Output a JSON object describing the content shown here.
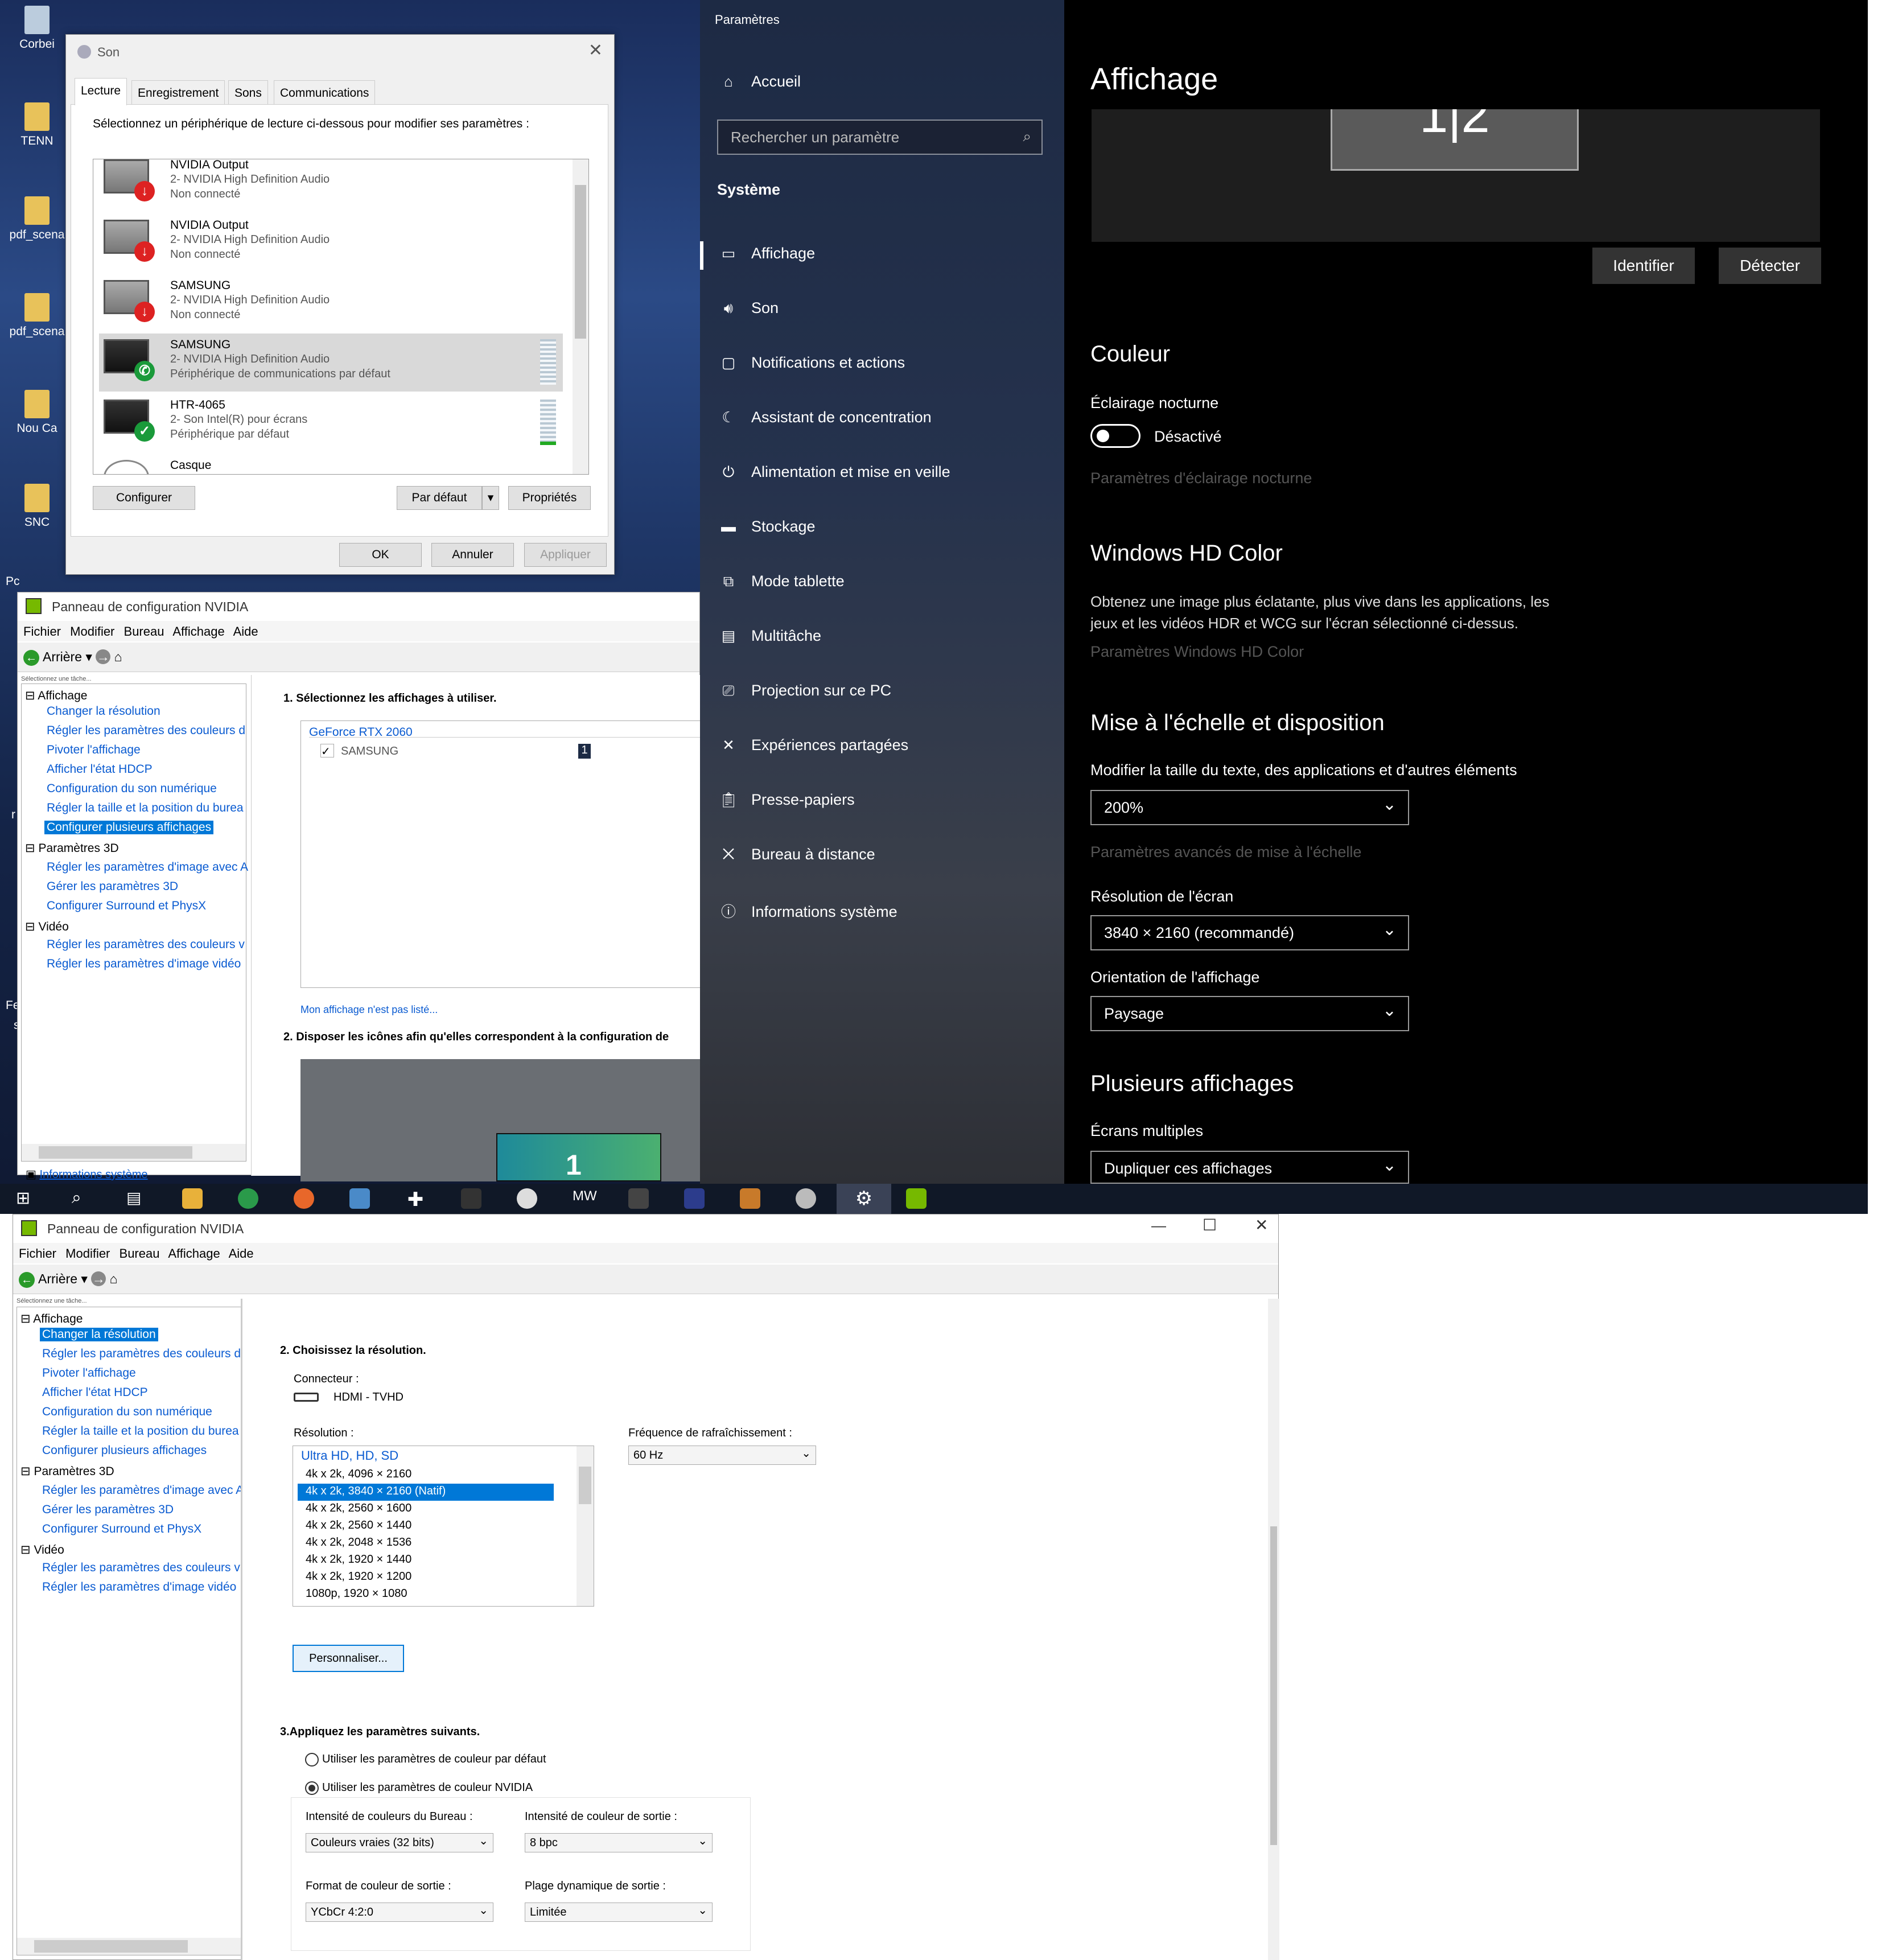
{
  "desktop": {
    "icons": [
      "Corbei",
      "TENN",
      "pdf_scena",
      "pdf_scena",
      "Nou Ca",
      "SNC"
    ],
    "side_labels": [
      "Pc",
      "r",
      "Fe",
      "s"
    ]
  },
  "sound": {
    "title": "Son",
    "tabs": [
      "Lecture",
      "Enregistrement",
      "Sons",
      "Communications"
    ],
    "instruction": "Sélectionnez un périphérique de lecture ci-dessous pour modifier ses paramètres :",
    "devices": [
      {
        "name": "NVIDIA Output",
        "line2": "2- NVIDIA High Definition Audio",
        "line3": "Non connecté",
        "status": "disconnected"
      },
      {
        "name": "NVIDIA Output",
        "line2": "2- NVIDIA High Definition Audio",
        "line3": "Non connecté",
        "status": "disconnected"
      },
      {
        "name": "SAMSUNG",
        "line2": "2- NVIDIA High Definition Audio",
        "line3": "Non connecté",
        "status": "disconnected"
      },
      {
        "name": "SAMSUNG",
        "line2": "2- NVIDIA High Definition Audio",
        "line3": "Périphérique de communications par défaut",
        "status": "comm"
      },
      {
        "name": "HTR-4065",
        "line2": "2- Son Intel(R) pour écrans",
        "line3": "Périphérique par défaut",
        "status": "default"
      },
      {
        "name": "Casque",
        "line2": "",
        "line3": "",
        "status": "none"
      }
    ],
    "btn_configure": "Configurer",
    "btn_default": "Par défaut",
    "btn_properties": "Propriétés",
    "btn_ok": "OK",
    "btn_cancel": "Annuler",
    "btn_apply": "Appliquer"
  },
  "nv1": {
    "title": "Panneau de configuration NVIDIA",
    "menu": [
      "Fichier",
      "Modifier",
      "Bureau",
      "Affichage",
      "Aide"
    ],
    "back": "Arrière",
    "task_hint": "Sélectionnez une tâche...",
    "tree": {
      "affichage": "Affichage",
      "affichage_items": [
        "Changer la résolution",
        "Régler les paramètres des couleurs d",
        "Pivoter l'affichage",
        "Afficher l'état HDCP",
        "Configuration du son numérique",
        "Régler la taille et la position du burea",
        "Configurer plusieurs affichages"
      ],
      "p3d": "Paramètres 3D",
      "p3d_items": [
        "Régler les paramètres d'image avec A",
        "Gérer les paramètres 3D",
        "Configurer Surround et PhysX"
      ],
      "video": "Vidéo",
      "video_items": [
        "Régler les paramètres des couleurs v",
        "Régler les paramètres d'image vidéo"
      ]
    },
    "sysinfo": "Informations système",
    "step1": "1. Sélectionnez les affichages à utiliser.",
    "gpu": "GeForce RTX 2060",
    "display": "SAMSUNG",
    "display_num": "1",
    "not_listed": "Mon affichage n'est pas listé...",
    "step2": "2. Disposer les icônes afin qu'elles correspondent à la configuration de",
    "preview_num": "1"
  },
  "settings": {
    "title": "Paramètres",
    "home": "Accueil",
    "search_placeholder": "Rechercher un paramètre",
    "system": "Système",
    "nav": [
      {
        "icon": "display-icon",
        "label": "Affichage"
      },
      {
        "icon": "sound-icon",
        "label": "Son"
      },
      {
        "icon": "notifications-icon",
        "label": "Notifications et actions"
      },
      {
        "icon": "focus-assist-icon",
        "label": "Assistant de concentration"
      },
      {
        "icon": "power-icon",
        "label": "Alimentation et mise en veille"
      },
      {
        "icon": "storage-icon",
        "label": "Stockage"
      },
      {
        "icon": "tablet-icon",
        "label": "Mode tablette"
      },
      {
        "icon": "multitask-icon",
        "label": "Multitâche"
      },
      {
        "icon": "projection-icon",
        "label": "Projection sur ce PC"
      },
      {
        "icon": "shared-icon",
        "label": "Expériences partagées"
      },
      {
        "icon": "clipboard-icon",
        "label": "Presse-papiers"
      },
      {
        "icon": "remote-icon",
        "label": "Bureau à distance"
      },
      {
        "icon": "info-icon",
        "label": "Informations système"
      }
    ],
    "page_title": "Affichage",
    "monitor_label": "1|2",
    "btn_identify": "Identifier",
    "btn_detect": "Détecter",
    "couleur": "Couleur",
    "night_light": "Éclairage nocturne",
    "night_state": "Désactivé",
    "night_link": "Paramètres d'éclairage nocturne",
    "hd_title": "Windows HD Color",
    "hd_desc1": "Obtenez une image plus éclatante, plus vive dans les applications, les",
    "hd_desc2": "jeux et les vidéos HDR et WCG sur l'écran sélectionné ci-dessus.",
    "hd_link": "Paramètres Windows HD Color",
    "scale_title": "Mise à l'échelle et disposition",
    "scale_label": "Modifier la taille du texte, des applications et d'autres éléments",
    "scale_value": "200%",
    "scale_link": "Paramètres avancés de mise à l'échelle",
    "res_label": "Résolution de l'écran",
    "res_value": "3840 × 2160 (recommandé)",
    "orient_label": "Orientation de l'affichage",
    "orient_value": "Paysage",
    "multi_title": "Plusieurs affichages",
    "multi_label": "Écrans multiples",
    "multi_value": "Dupliquer ces affichages"
  },
  "nv2": {
    "title": "Panneau de configuration NVIDIA",
    "menu": [
      "Fichier",
      "Modifier",
      "Bureau",
      "Affichage",
      "Aide"
    ],
    "back": "Arrière",
    "task_hint": "Sélectionnez une tâche...",
    "tree": {
      "affichage": "Affichage",
      "affichage_items": [
        "Changer la résolution",
        "Régler les paramètres des couleurs d",
        "Pivoter l'affichage",
        "Afficher l'état HDCP",
        "Configuration du son numérique",
        "Régler la taille et la position du burea",
        "Configurer plusieurs affichages"
      ],
      "p3d": "Paramètres 3D",
      "p3d_items": [
        "Régler les paramètres d'image avec A",
        "Gérer les paramètres 3D",
        "Configurer Surround et PhysX"
      ],
      "video": "Vidéo",
      "video_items": [
        "Régler les paramètres des couleurs v",
        "Régler les paramètres d'image vidéo"
      ]
    },
    "step2": "2. Choisissez la résolution.",
    "connector_label": "Connecteur :",
    "connector": "HDMI - TVHD",
    "res_label": "Résolution :",
    "refresh_label": "Fréquence de rafraîchissement :",
    "refresh_value": "60 Hz",
    "res_group": "Ultra HD, HD, SD",
    "resolutions": [
      "4k x 2k, 4096 × 2160",
      "4k x 2k, 3840 × 2160 (Natif)",
      "4k x 2k, 2560 × 1600",
      "4k x 2k, 2560 × 1440",
      "4k x 2k, 2048 × 1536",
      "4k x 2k, 1920 × 1440",
      "4k x 2k, 1920 × 1200",
      "1080p, 1920 × 1080"
    ],
    "customize": "Personnaliser...",
    "step3": "3.Appliquez les paramètres suivants.",
    "radio_default": "Utiliser les paramètres de couleur par défaut",
    "radio_nvidia": "Utiliser les paramètres de couleur NVIDIA",
    "desk_depth_label": "Intensité de couleurs du Bureau :",
    "desk_depth": "Couleurs vraies (32 bits)",
    "out_depth_label": "Intensité de couleur de sortie :",
    "out_depth": "8 bpc",
    "out_format_label": "Format de couleur de sortie :",
    "out_format": "YCbCr 4:2:0",
    "dyn_range_label": "Plage dynamique de sortie :",
    "dyn_range": "Limitée"
  },
  "colors": {
    "accent": "#0078d7",
    "nvidia_green": "#76b900",
    "settings_bg": "#000000"
  }
}
